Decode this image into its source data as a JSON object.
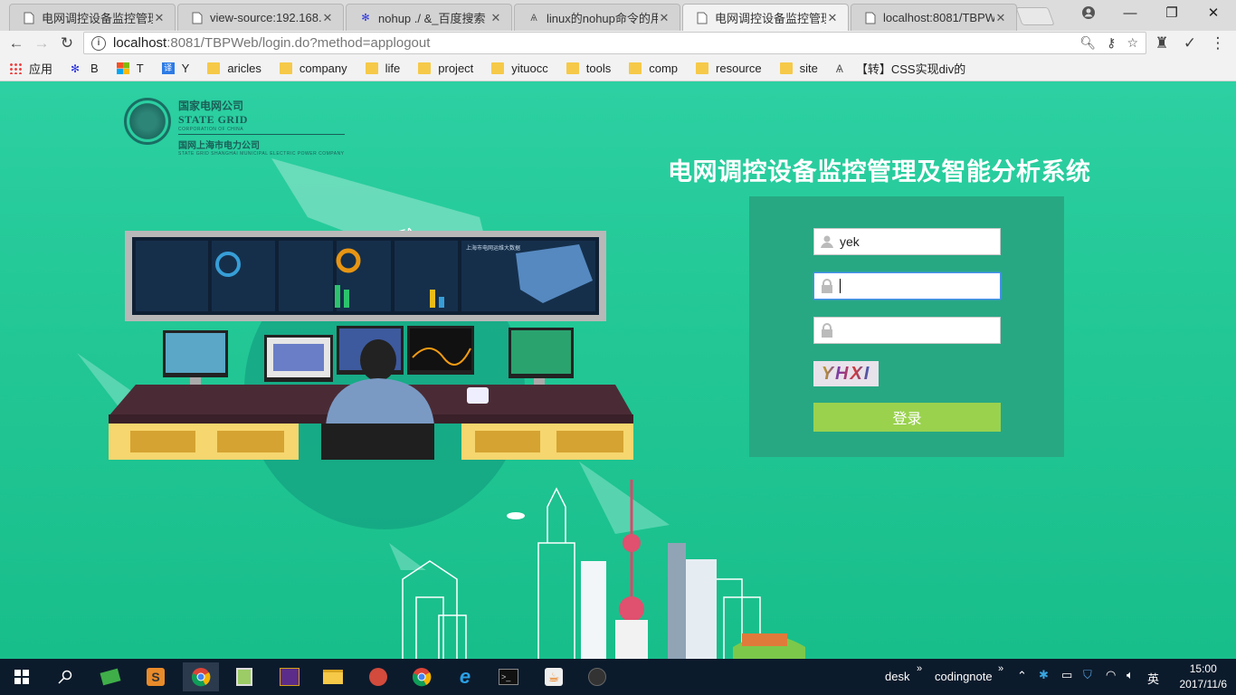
{
  "browser": {
    "tabs": [
      {
        "title": "电网调控设备监控管理",
        "icon": "page-icon",
        "active": false
      },
      {
        "title": "view-source:192.168.",
        "icon": "page-icon",
        "active": false
      },
      {
        "title": "nohup ./ &_百度搜索",
        "icon": "baidu-paw-icon",
        "active": false
      },
      {
        "title": "linux的nohup命令的用",
        "icon": "site-icon",
        "active": false
      },
      {
        "title": "电网调控设备监控管理",
        "icon": "page-icon",
        "active": true
      },
      {
        "title": "localhost:8081/TBPW",
        "icon": "page-icon",
        "active": false
      }
    ],
    "url_host": "localhost",
    "url_path": ":8081/TBPWeb/login.do?method=applogout",
    "bookmarks": [
      {
        "label": "应用",
        "icon": "apps-grid-icon"
      },
      {
        "label": "B",
        "icon": "baidu-paw-icon"
      },
      {
        "label": "T",
        "icon": "windows-icon"
      },
      {
        "label": "Y",
        "icon": "translate-icon"
      },
      {
        "label": "aricles",
        "icon": "folder-icon"
      },
      {
        "label": "company",
        "icon": "folder-icon"
      },
      {
        "label": "life",
        "icon": "folder-icon"
      },
      {
        "label": "project",
        "icon": "folder-icon"
      },
      {
        "label": "yituocc",
        "icon": "folder-icon"
      },
      {
        "label": "tools",
        "icon": "folder-icon"
      },
      {
        "label": "comp",
        "icon": "folder-icon"
      },
      {
        "label": "resource",
        "icon": "folder-icon"
      },
      {
        "label": "site",
        "icon": "folder-icon"
      },
      {
        "label": "【转】CSS实现div的",
        "icon": "site-icon"
      }
    ]
  },
  "logo": {
    "cn": "国家电网公司",
    "en": "STATE GRID",
    "sub": "CORPORATION OF CHINA",
    "cn2": "国网上海市电力公司",
    "en2": "STATE GRID SHANGHAI MUNICIPAL ELECTRIC POWER COMPANY"
  },
  "system_title": "电网调控设备监控管理及智能分析系统",
  "login": {
    "username": "yek",
    "password": "",
    "captcha_input": "",
    "captcha_text": "YHXI",
    "submit_label": "登录"
  },
  "illustration": {
    "big_data": "BIG DATA",
    "map_title": "上海市电网运维大数据"
  },
  "taskbar": {
    "labels": [
      "desk",
      "codingnote"
    ],
    "ime": "英",
    "time": "15:00",
    "date": "2017/11/6"
  },
  "colors": {
    "page_bg": "#22c795",
    "panel_bg": "#27a883",
    "login_button": "#9ad24e"
  }
}
